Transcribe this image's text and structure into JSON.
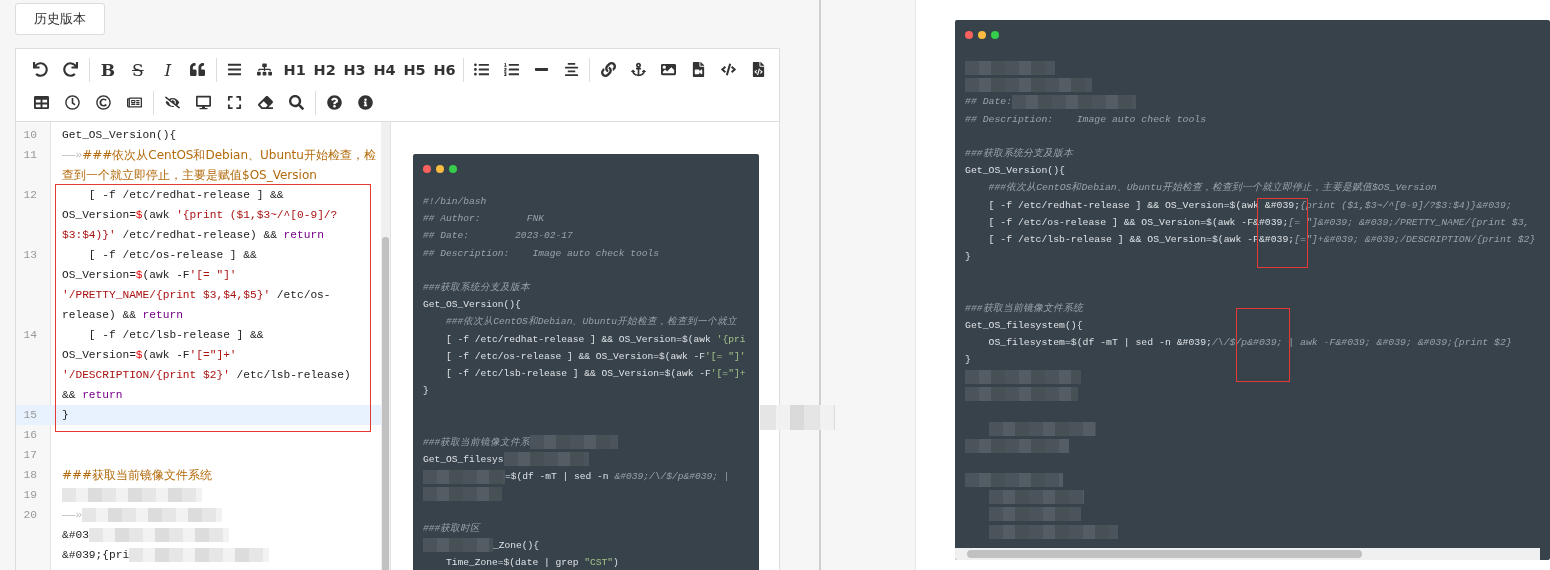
{
  "history_button": "历史版本",
  "toolbar": {
    "rows": [
      [
        [
          {
            "kind": "icon"
          },
          {
            "kind": "icon"
          }
        ],
        [
          {
            "kind": "bold",
            "label": "B"
          },
          {
            "kind": "strike",
            "label": "S"
          },
          {
            "kind": "italic",
            "label": "I"
          },
          {
            "kind": "icon"
          }
        ],
        [
          {
            "kind": "icon"
          },
          {
            "kind": "icon"
          },
          {
            "kind": "heading",
            "label": "H1"
          },
          {
            "kind": "heading",
            "label": "H2"
          },
          {
            "kind": "heading",
            "label": "H3"
          },
          {
            "kind": "heading",
            "label": "H4"
          },
          {
            "kind": "heading",
            "label": "H5"
          },
          {
            "kind": "heading",
            "label": "H6"
          }
        ],
        [
          {
            "kind": "icon"
          },
          {
            "kind": "icon"
          },
          {
            "kind": "icon"
          },
          {
            "kind": "icon"
          }
        ],
        [
          {
            "kind": "icon"
          },
          {
            "kind": "icon"
          },
          {
            "kind": "icon"
          },
          {
            "kind": "icon"
          },
          {
            "kind": "icon"
          },
          {
            "kind": "icon"
          }
        ]
      ],
      [
        [
          {
            "kind": "icon"
          },
          {
            "kind": "icon"
          },
          {
            "kind": "icon"
          },
          {
            "kind": "icon"
          }
        ],
        [
          {
            "kind": "icon"
          },
          {
            "kind": "icon"
          },
          {
            "kind": "icon"
          },
          {
            "kind": "icon"
          },
          {
            "kind": "icon"
          }
        ],
        [
          {
            "kind": "icon"
          },
          {
            "kind": "icon"
          }
        ]
      ]
    ]
  },
  "editor": {
    "lines": [
      {
        "number": "10",
        "active": false,
        "rows": [
          {
            "segments": [
              {
                "kind": "plain",
                "text": "Get_OS_Version(){"
              }
            ]
          }
        ]
      },
      {
        "number": "11",
        "active": false,
        "rows": [
          {
            "segments": [
              {
                "kind": "tab",
                "text": "——»"
              },
              {
                "kind": "comment",
                "text": "###依次从CentOS和Debian、Ubuntu开始检查，检"
              }
            ]
          },
          {
            "segments": [
              {
                "kind": "comment",
                "text": "查到一个就立即停止，主要是赋值$OS_Version"
              }
            ]
          }
        ]
      },
      {
        "number": "12",
        "active": false,
        "rows": [
          {
            "segments": [
              {
                "kind": "plain",
                "text": "    [ -f /etc/redhat-release ] &&"
              }
            ]
          },
          {
            "segments": [
              {
                "kind": "plain",
                "text": "OS_Version="
              },
              {
                "kind": "var",
                "text": "$"
              },
              {
                "kind": "plain",
                "text": "(awk "
              },
              {
                "kind": "string",
                "text": "'{print ($1,$3~/^[0-9]/?"
              }
            ]
          },
          {
            "segments": [
              {
                "kind": "string",
                "text": "$3:$4)}'"
              },
              {
                "kind": "plain",
                "text": " /etc/redhat-release) && "
              },
              {
                "kind": "keyword",
                "text": "return"
              }
            ]
          }
        ]
      },
      {
        "number": "13",
        "active": false,
        "rows": [
          {
            "segments": [
              {
                "kind": "plain",
                "text": "    [ -f /etc/os-release ] &&"
              }
            ]
          },
          {
            "segments": [
              {
                "kind": "plain",
                "text": "OS_Version="
              },
              {
                "kind": "var",
                "text": "$"
              },
              {
                "kind": "plain",
                "text": "(awk -F"
              },
              {
                "kind": "string",
                "text": "'[= \"]'"
              }
            ]
          },
          {
            "segments": [
              {
                "kind": "string",
                "text": "'/PRETTY_NAME/{print $3,$4,$5}'"
              },
              {
                "kind": "plain",
                "text": " /etc/os-"
              }
            ]
          },
          {
            "segments": [
              {
                "kind": "plain",
                "text": "release) && "
              },
              {
                "kind": "keyword",
                "text": "return"
              }
            ]
          }
        ]
      },
      {
        "number": "14",
        "active": false,
        "rows": [
          {
            "segments": [
              {
                "kind": "plain",
                "text": "    [ -f /etc/lsb-release ] &&"
              }
            ]
          },
          {
            "segments": [
              {
                "kind": "plain",
                "text": "OS_Version="
              },
              {
                "kind": "var",
                "text": "$"
              },
              {
                "kind": "plain",
                "text": "(awk -F"
              },
              {
                "kind": "string",
                "text": "'[=\"]+'"
              }
            ]
          },
          {
            "segments": [
              {
                "kind": "string",
                "text": "'/DESCRIPTION/{print $2}'"
              },
              {
                "kind": "plain",
                "text": " /etc/lsb-release)"
              }
            ]
          },
          {
            "segments": [
              {
                "kind": "plain",
                "text": "&& "
              },
              {
                "kind": "keyword",
                "text": "return"
              }
            ]
          }
        ]
      },
      {
        "number": "15",
        "active": true,
        "rows": [
          {
            "segments": [
              {
                "kind": "plain",
                "text": "}"
              }
            ]
          }
        ]
      },
      {
        "number": "16",
        "active": false
      },
      {
        "number": "17",
        "active": false
      },
      {
        "number": "18",
        "active": false,
        "rows": [
          {
            "segments": [
              {
                "kind": "comment",
                "text": "###获取当前镜像文件系统"
              }
            ]
          }
        ]
      },
      {
        "number": "19",
        "active": false,
        "rows": [
          {
            "segments": [
              {
                "kind": "smudge"
              }
            ]
          }
        ]
      },
      {
        "number": "20",
        "active": false,
        "rows": [
          {
            "segments": [
              {
                "kind": "tab",
                "text": "——»"
              },
              {
                "kind": "smudge"
              }
            ]
          },
          {
            "segments": [
              {
                "kind": "plain",
                "text": "&#03"
              },
              {
                "kind": "smudge"
              }
            ]
          },
          {
            "segments": [
              {
                "kind": "plain",
                "text": "&#039;{pri"
              },
              {
                "kind": "smudge"
              }
            ]
          }
        ]
      }
    ]
  },
  "preview_code": {
    "lines": [
      {
        "kind": "code",
        "segments": [
          {
            "kind": "comment",
            "text": "#!/bin/bash"
          }
        ]
      },
      {
        "kind": "code",
        "segments": [
          {
            "kind": "comment",
            "text": "## Author:        FNK"
          }
        ]
      },
      {
        "kind": "code",
        "segments": [
          {
            "kind": "comment",
            "text": "## Date:        2023-02-17"
          }
        ]
      },
      {
        "kind": "code",
        "segments": [
          {
            "kind": "comment",
            "text": "## Description:    Image auto check tools"
          }
        ]
      },
      {
        "kind": "blank"
      },
      {
        "kind": "code",
        "segments": [
          {
            "kind": "comment",
            "text": "###获取系统分支及版本"
          }
        ]
      },
      {
        "kind": "code",
        "segments": [
          {
            "kind": "plain",
            "text": "Get_OS_Version(){"
          }
        ]
      },
      {
        "kind": "code",
        "segments": [
          {
            "kind": "comment",
            "text": "    ###依次从CentOS和Debian、Ubuntu开始检查，检查到一个就立"
          }
        ]
      },
      {
        "kind": "code",
        "segments": [
          {
            "kind": "plain",
            "text": "    [ -f /etc/redhat-release ] && OS_Version=$(awk "
          },
          {
            "kind": "string",
            "text": "'{pri"
          }
        ]
      },
      {
        "kind": "code",
        "segments": [
          {
            "kind": "plain",
            "text": "    [ -f /etc/os-release ] && OS_Version=$(awk -F"
          },
          {
            "kind": "string",
            "text": "'[= \"]'"
          }
        ]
      },
      {
        "kind": "code",
        "segments": [
          {
            "kind": "plain",
            "text": "    [ -f /etc/lsb-release ] && OS_Version=$(awk -F"
          },
          {
            "kind": "string",
            "text": "'[=\"]+"
          }
        ]
      },
      {
        "kind": "code",
        "segments": [
          {
            "kind": "plain",
            "text": "}"
          }
        ]
      },
      {
        "kind": "blank"
      },
      {
        "kind": "blank"
      },
      {
        "kind": "code",
        "segments": [
          {
            "kind": "comment",
            "text": "###获取当前镜像文件系"
          },
          {
            "kind": "smudge"
          }
        ]
      },
      {
        "kind": "code",
        "segments": [
          {
            "kind": "plain",
            "text": "Get_OS_filesys"
          },
          {
            "kind": "smudge"
          }
        ]
      },
      {
        "kind": "code",
        "segments": [
          {
            "kind": "smudge"
          },
          {
            "kind": "plain",
            "text": "=$(df -mT | sed -n "
          },
          {
            "kind": "comment",
            "text": "&#039;/\\/$/p&#039; |"
          }
        ]
      },
      {
        "kind": "code",
        "segments": [
          {
            "kind": "smudge"
          }
        ]
      },
      {
        "kind": "blank"
      },
      {
        "kind": "code",
        "segments": [
          {
            "kind": "comment",
            "text": "###获取时区"
          }
        ]
      },
      {
        "kind": "code",
        "segments": [
          {
            "kind": "smudge"
          },
          {
            "kind": "plain",
            "text": "_Zone(){"
          }
        ]
      },
      {
        "kind": "code",
        "segments": [
          {
            "kind": "plain",
            "text": "    Time_Zone=$(date | grep "
          },
          {
            "kind": "string",
            "text": "\"CST\""
          },
          {
            "kind": "plain",
            "text": ")"
          }
        ]
      }
    ]
  },
  "rendered_code": {
    "lines": [
      {
        "kind": "code",
        "segments": [
          {
            "kind": "smudge"
          }
        ]
      },
      {
        "kind": "code",
        "segments": [
          {
            "kind": "smudge"
          }
        ]
      },
      {
        "kind": "code",
        "segments": [
          {
            "kind": "comment",
            "text": "## Date:"
          },
          {
            "kind": "smudge"
          }
        ]
      },
      {
        "kind": "code",
        "segments": [
          {
            "kind": "comment",
            "text": "## Description:    Image auto check tools"
          }
        ]
      },
      {
        "kind": "blank"
      },
      {
        "kind": "code",
        "segments": [
          {
            "kind": "comment",
            "text": "###获取系统分支及版本"
          }
        ]
      },
      {
        "kind": "code",
        "segments": [
          {
            "kind": "plain",
            "text": "Get_OS_Version(){"
          }
        ]
      },
      {
        "kind": "code",
        "segments": [
          {
            "kind": "comment",
            "text": "    ###依次从CentOS和Debian、Ubuntu开始检查，检查到一个就立即停止，主要是赋值$OS_Version"
          }
        ]
      },
      {
        "kind": "code",
        "segments": [
          {
            "kind": "plain",
            "text": "    [ -f /etc/redhat-release ] && OS_Version=$(awk &#039;"
          },
          {
            "kind": "comment",
            "text": "{print ($1,$3~/^[0-9]/?$3:$4)}&#039;"
          }
        ]
      },
      {
        "kind": "code",
        "segments": [
          {
            "kind": "plain",
            "text": "    [ -f /etc/os-release ] && OS_Version=$(awk -F&#039;"
          },
          {
            "kind": "comment",
            "text": "[= \"]&#039; &#039;/PRETTY_NAME/{print $3,"
          }
        ]
      },
      {
        "kind": "code",
        "segments": [
          {
            "kind": "plain",
            "text": "    [ -f /etc/lsb-release ] && OS_Version=$(awk -F&#039;"
          },
          {
            "kind": "comment",
            "text": "[=\"]+&#039; &#039;/DESCRIPTION/{print $2}"
          }
        ]
      },
      {
        "kind": "code",
        "segments": [
          {
            "kind": "plain",
            "text": "}"
          }
        ]
      },
      {
        "kind": "blank"
      },
      {
        "kind": "blank"
      },
      {
        "kind": "code",
        "segments": [
          {
            "kind": "comment",
            "text": "###获取当前镜像文件系统"
          }
        ]
      },
      {
        "kind": "code",
        "segments": [
          {
            "kind": "plain",
            "text": "Get_OS_filesystem(){"
          }
        ]
      },
      {
        "kind": "code",
        "segments": [
          {
            "kind": "plain",
            "text": "    OS_filesystem=$(df -mT | sed -n &#039;"
          },
          {
            "kind": "comment",
            "text": "/\\/$/p&#039; | awk -F&#039; &#039; &#039;{print $2}"
          }
        ]
      },
      {
        "kind": "code",
        "segments": [
          {
            "kind": "plain",
            "text": "}"
          }
        ]
      },
      {
        "kind": "code",
        "segments": [
          {
            "kind": "smudge"
          }
        ]
      },
      {
        "kind": "code",
        "segments": [
          {
            "kind": "smudge"
          }
        ]
      },
      {
        "kind": "blank"
      },
      {
        "kind": "code",
        "segments": [
          {
            "kind": "smudge_indent"
          }
        ]
      },
      {
        "kind": "code",
        "segments": [
          {
            "kind": "smudge"
          }
        ]
      },
      {
        "kind": "blank"
      },
      {
        "kind": "code",
        "segments": [
          {
            "kind": "smudge"
          }
        ]
      },
      {
        "kind": "code",
        "segments": [
          {
            "kind": "smudge_indent"
          }
        ]
      },
      {
        "kind": "code",
        "segments": [
          {
            "kind": "smudge_indent"
          }
        ]
      },
      {
        "kind": "code",
        "segments": [
          {
            "kind": "smudge_indent"
          }
        ]
      }
    ]
  }
}
